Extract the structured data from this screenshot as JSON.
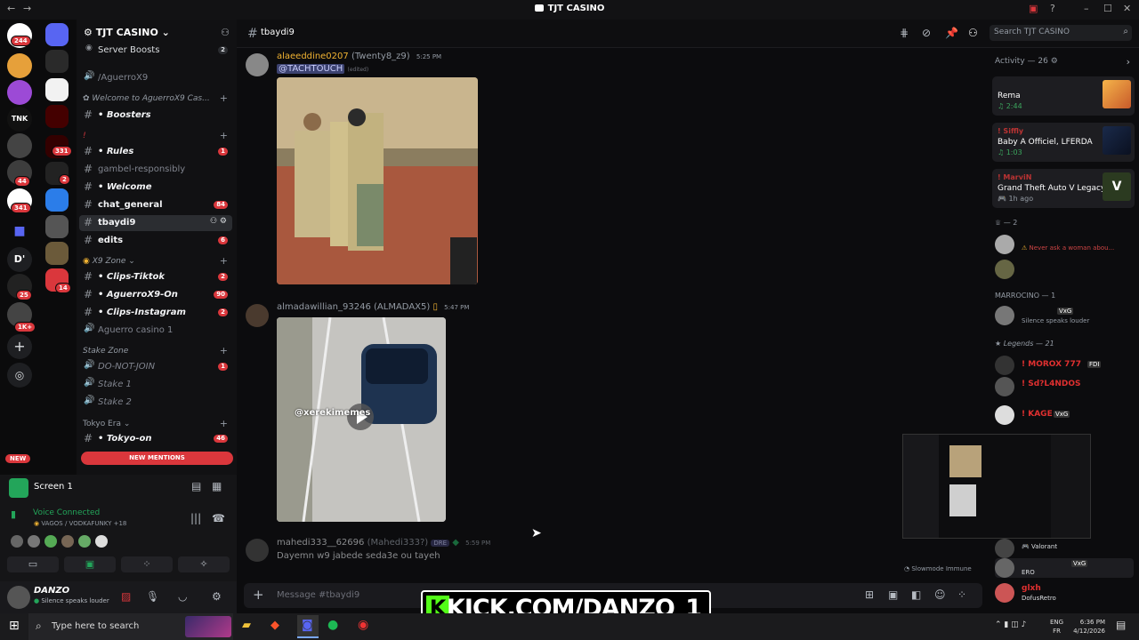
{
  "window": {
    "title": "TJT CASINO"
  },
  "servers": {
    "badges": [
      "244",
      "331",
      "2",
      "44",
      "341",
      "25",
      "1K+",
      "14"
    ],
    "dm_label": "D'",
    "tnk_label": "TNK"
  },
  "server_name": "TJT CASINO",
  "channels": {
    "server_boosts": {
      "label": "Server Boosts",
      "count": "2"
    },
    "aguerro": "/AguerroX9",
    "welcome_cat": "Welcome to AguerroX9 Cas...",
    "boosters": "• Boosters",
    "red_cat": "!",
    "rules": {
      "label": "• Rules",
      "badge": "1"
    },
    "gambel": "gambel-responsibly",
    "welcome": "• Welcome",
    "chat_general": {
      "label": "chat_general",
      "badge": "84"
    },
    "tbaydi9": "tbaydi9",
    "edits": {
      "label": "edits",
      "badge": "6"
    },
    "x9_zone": "X9 Zone",
    "clips_tiktok": {
      "label": "• Clips-Tiktok",
      "badge": "2"
    },
    "aguerro_on": {
      "label": "• AguerroX9-On",
      "badge": "90"
    },
    "clips_insta": {
      "label": "• Clips-Instagram",
      "badge": "2"
    },
    "aguerro_casino": "Aguerro casino 1",
    "stake_zone": "Stake Zone",
    "do_not_join": {
      "label": "DO-NOT-JOIN",
      "badge": "1"
    },
    "stake1": "Stake 1",
    "stake2": "Stake 2",
    "tokyo_era": "Tokyo Era",
    "tokyo_on": {
      "label": "• Tokyo-on",
      "badge": "46"
    },
    "new_mentions": "NEW MENTIONS",
    "new_pill": "NEW"
  },
  "screen_panel": {
    "title": "Screen 1",
    "voice_status": "Voice Connected",
    "voice_channel": "VAGOS / VODKAFUNKY +18"
  },
  "user": {
    "name": "DANZO",
    "status": "Silence speaks louder"
  },
  "header": {
    "channel": "tbaydi9",
    "search_placeholder": "Search TJT CASINO"
  },
  "messages": [
    {
      "user": "alaeeddine0207",
      "alias": "(Twenty8_z9)",
      "time": "5:25 PM",
      "mention": "@TACHTOUCH",
      "edited": "(edited)"
    },
    {
      "user": "almadawillian_93246",
      "alias": "(ALMADAX5)",
      "time": "5:47 PM",
      "video_caption": "@xerekimemes"
    },
    {
      "user": "mahedi333__62696",
      "alias": "(Mahedi333?)",
      "tag": "DRE",
      "time": "5:59 PM",
      "text": "Dayemn w9 jabede seda3e ou tayeh"
    }
  ],
  "slowmode": "Slowmode Immune",
  "input_placeholder": "Message #tbaydi9",
  "members": {
    "activity_header": "Activity — 26",
    "activities": [
      {
        "name": "",
        "title": "Rema",
        "sub": "2:44"
      },
      {
        "name": "! Siffly",
        "title": "Baby A Officiel, LFERDA",
        "sub": "1:03"
      },
      {
        "name": "! MarviN",
        "title": "Grand Theft Auto V Legacy",
        "sub": "1h ago"
      }
    ],
    "sec2": "— 2",
    "warn_status": "Never ask a woman abou...",
    "marrocino": "MARROCINO — 1",
    "silence": "Silence speaks louder",
    "vxg": "VxG",
    "legends": "Legends — 21",
    "legend_members": [
      "! MOROX 777",
      "! Sd?L4NDOS",
      "! KAGE"
    ],
    "fdi": "FDI",
    "bottom": [
      "Valorant",
      "ERO",
      "DofusRetro"
    ],
    "glxh": "glxh"
  },
  "kick_banner": "KICK.COM/DANZO_1",
  "taskbar": {
    "search_placeholder": "Type here to search",
    "lang1": "ENG",
    "lang2": "FR",
    "time": "6:36 PM",
    "date": "4/12/2026"
  }
}
